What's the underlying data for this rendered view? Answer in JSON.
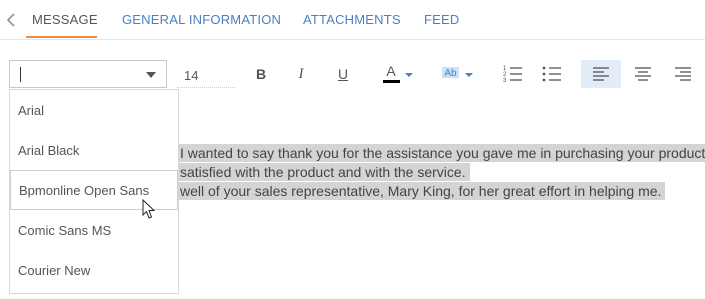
{
  "tabs": [
    {
      "label": "MESSAGE",
      "active": true
    },
    {
      "label": "GENERAL INFORMATION",
      "active": false
    },
    {
      "label": "ATTACHMENTS",
      "active": false
    },
    {
      "label": "FEED",
      "active": false
    }
  ],
  "toolbar": {
    "font_value": "",
    "font_size": "14",
    "bold_label": "B",
    "italic_label": "I",
    "underline_label": "U",
    "font_color_label": "A",
    "highlight_label": "Ab",
    "icons": [
      "chevron-left-icon",
      "dropdown-arrow-icon",
      "font-color-icon",
      "highlight-icon",
      "numbered-list-icon",
      "bulleted-list-icon",
      "align-left-icon",
      "align-center-icon",
      "align-right-icon",
      "pointer-cursor-icon"
    ],
    "accent_color": "#f08a3c",
    "link_color": "#4c7fc0",
    "font_color_swatch": "#000000",
    "highlight_active_bg": "#e3edf9"
  },
  "font_dropdown": {
    "options": [
      "Arial",
      "Arial Black",
      "Bpmonline Open Sans",
      "Comic Sans MS",
      "Courier New"
    ],
    "hovered": "Bpmonline Open Sans"
  },
  "editor": {
    "lines": [
      "I wanted to say thank you for the assistance you gave me in purchasing your product.",
      "satisfied with the product and with the service.",
      "well of your sales representative, Mary King, for her great effort in helping me."
    ],
    "selection_color": "#d4d4d4"
  }
}
